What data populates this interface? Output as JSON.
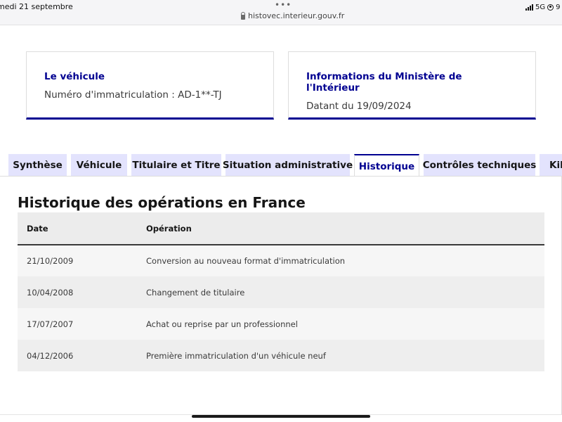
{
  "status_bar": {
    "date": "medi 21 septembre",
    "url": "histovec.interieur.gouv.fr",
    "network": "5G",
    "battery_fragment": "9"
  },
  "cards": [
    {
      "title": "Le véhicule",
      "text": "Numéro d'immatriculation : AD-1**-TJ"
    },
    {
      "title": "Informations du Ministère de l'Intérieur",
      "text": "Datant du 19/09/2024"
    }
  ],
  "tabs": [
    {
      "label": "Synthèse"
    },
    {
      "label": "Véhicule"
    },
    {
      "label": "Titulaire et Titre"
    },
    {
      "label": "Situation administrative"
    },
    {
      "label": "Historique",
      "active": true
    },
    {
      "label": "Contrôles techniques"
    },
    {
      "label": "Kilo"
    }
  ],
  "history": {
    "title": "Historique des opérations en France",
    "columns": [
      "Date",
      "Opération"
    ],
    "rows": [
      {
        "date": "21/10/2009",
        "operation": "Conversion au nouveau format d'immatriculation"
      },
      {
        "date": "10/04/2008",
        "operation": "Changement de titulaire"
      },
      {
        "date": "17/07/2007",
        "operation": "Achat ou reprise par un professionnel"
      },
      {
        "date": "04/12/2006",
        "operation": "Première immatriculation d'un véhicule neuf"
      }
    ]
  },
  "colors": {
    "accent": "#000091",
    "tab_background": "#e3e3fd",
    "text": "#161616"
  }
}
